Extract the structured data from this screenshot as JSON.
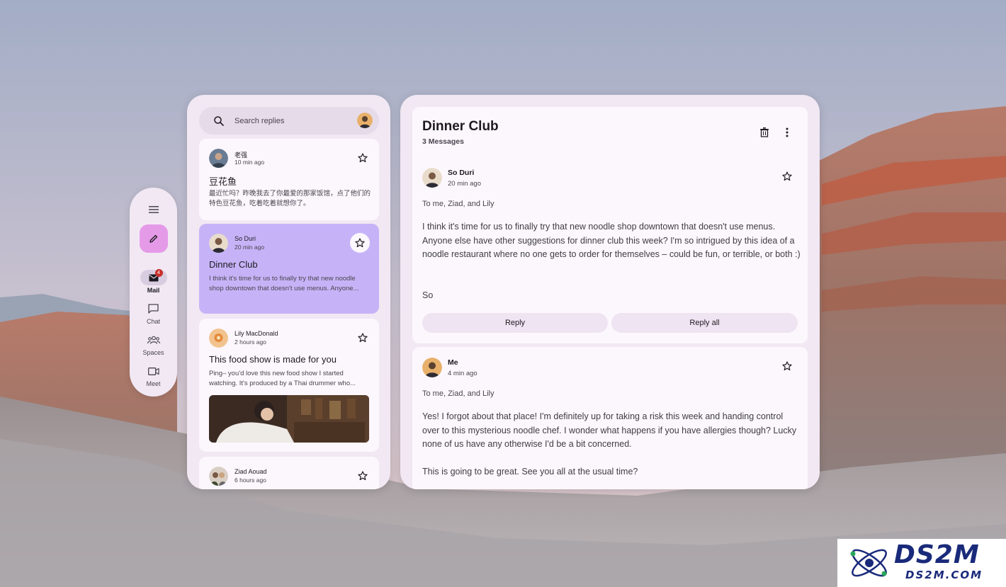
{
  "rail": {
    "items": [
      {
        "label": "Mail",
        "badge": "4",
        "active": true
      },
      {
        "label": "Chat",
        "active": false
      },
      {
        "label": "Spaces",
        "active": false
      },
      {
        "label": "Meet",
        "active": false
      }
    ]
  },
  "search": {
    "placeholder": "Search replies"
  },
  "list": {
    "cards": [
      {
        "sender": "老强",
        "time": "10 min ago",
        "subject": "豆花鱼",
        "preview": "最近忙吗？昨晚我去了你最爱的那家饭馆，点了他们的特色豆花鱼，吃着吃着就想你了。"
      },
      {
        "sender": "So Duri",
        "time": "20 min ago",
        "subject": "Dinner Club",
        "preview": "I think it's time for us to finally try that new noodle shop downtown that doesn't use menus. Anyone..."
      },
      {
        "sender": "Lily MacDonald",
        "time": "2 hours ago",
        "subject": "This food show is made for you",
        "preview": "Ping– you'd love this new food show I started watching. It's produced by a Thai drummer who..."
      },
      {
        "sender": "Ziad Aouad",
        "time": "6 hours ago"
      }
    ]
  },
  "detail": {
    "title": "Dinner Club",
    "count": "3 Messages",
    "messages": [
      {
        "sender": "So Duri",
        "time": "20 min ago",
        "to": "To me, Ziad, and Lily",
        "body": "I think it's time for us to finally try that new noodle shop downtown that doesn't use menus. Anyone else have other suggestions for dinner club this week? I'm so intrigued by this idea of a noodle restaurant where no one gets to order for themselves – could be fun, or terrible, or both :)",
        "signature": "So",
        "reply_label": "Reply",
        "reply_all_label": "Reply all"
      },
      {
        "sender": "Me",
        "time": "4 min ago",
        "to": "To me, Ziad, and Lily",
        "body": "Yes! I forgot about that place! I'm definitely up for taking a risk this week and handing control over to this mysterious noodle chef. I wonder what happens if you have allergies though? Lucky none of us have any otherwise I'd be a bit concerned.",
        "body2": "This is going to be great. See you all at the usual time?"
      }
    ]
  },
  "watermark": {
    "main": "DS2M",
    "sub": "DS2M.COM"
  },
  "colors": {
    "accent_selected": "#c6b3f7",
    "compose": "#e59ae8",
    "panel": "#f1e8f3",
    "card": "#fcf7fd"
  }
}
